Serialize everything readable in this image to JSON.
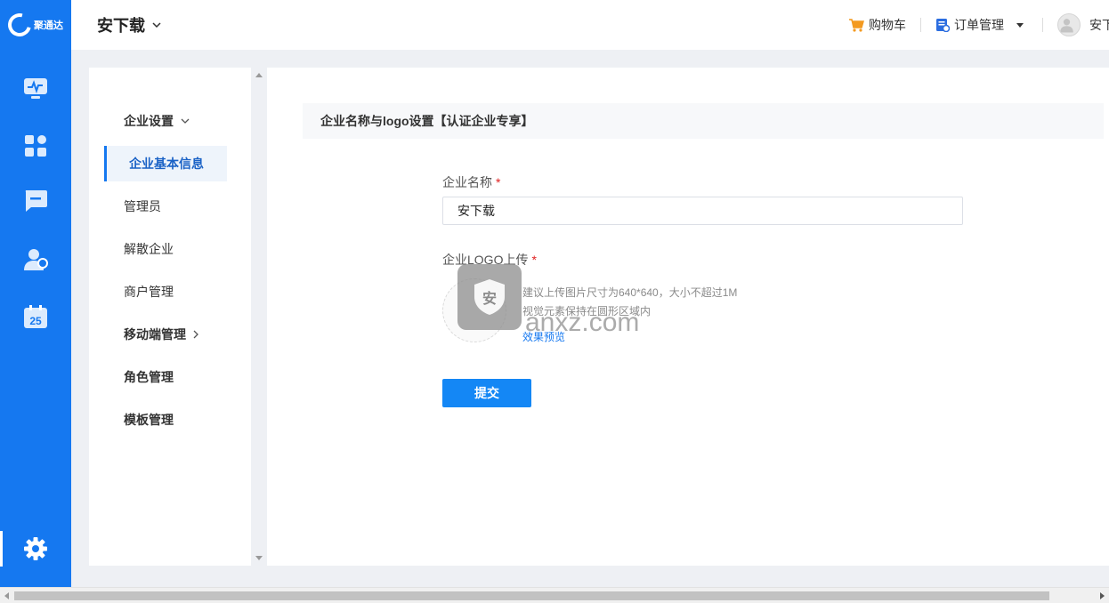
{
  "brand": {
    "name": "聚通达"
  },
  "topbar": {
    "tenant_name": "安下载",
    "cart_label": "购物车",
    "orders_label": "订单管理",
    "user_name": "安下"
  },
  "rail": {
    "items": [
      {
        "icon": "monitor-icon"
      },
      {
        "icon": "apps-grid-icon"
      },
      {
        "icon": "message-icon"
      },
      {
        "icon": "contacts-icon"
      },
      {
        "icon": "calendar-icon",
        "badge": "25"
      },
      {
        "icon": "gear-icon"
      }
    ]
  },
  "submenu": {
    "items": [
      {
        "label": "企业设置"
      },
      {
        "label": "企业基本信息"
      },
      {
        "label": "管理员"
      },
      {
        "label": "解散企业"
      },
      {
        "label": "商户管理"
      },
      {
        "label": "移动端管理"
      },
      {
        "label": "角色管理"
      },
      {
        "label": "模板管理"
      }
    ]
  },
  "form": {
    "section_title": "企业名称与logo设置【认证企业专享】",
    "name_label": "企业名称",
    "required_mark": "*",
    "name_value": "安下载",
    "logo_label": "企业LOGO上传",
    "hint_line1": "建议上传图片尺寸为640*640，大小不超过1M",
    "hint_line2": "视觉元素保持在圆形区域内",
    "preview_link": "效果预览",
    "submit_label": "提交"
  },
  "watermark": {
    "text": "anxz.com",
    "badge": "安"
  },
  "colors": {
    "brand_blue": "#1578f0",
    "button_blue": "#1487f5",
    "required_red": "#e02020"
  }
}
